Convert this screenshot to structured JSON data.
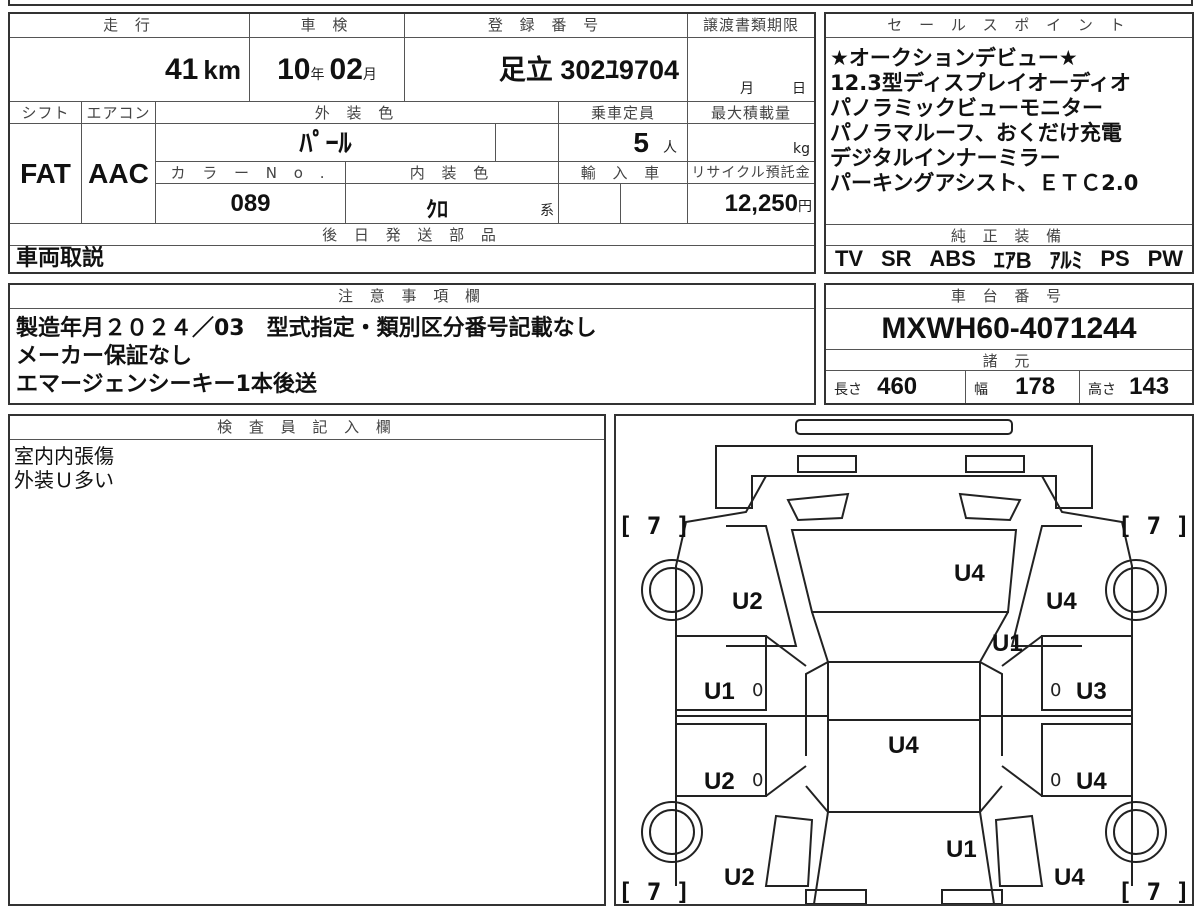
{
  "headers": {
    "mileage": "走 行",
    "inspection": "車 検",
    "registration": "登 録 番 号",
    "transfer_deadline": "譲渡書類期限",
    "shift": "シフト",
    "aircon": "エアコン",
    "exterior_color": "外 装 色",
    "capacity": "乗車定員",
    "max_load": "最大積載量",
    "color_no": "カ ラ ー N o .",
    "interior_color": "内 装 色",
    "import": "輸 入 車",
    "recycle": "リサイクル預託金",
    "later_parts": "後 日 発 送 部 品",
    "sales_points": "セ ー ル ス ポ イ ン ト",
    "genuine": "純 正 装 備",
    "notes": "注 意 事 項 欄",
    "chassis": "車 台 番 号",
    "specs": "諸 元",
    "inspector": "検 査 員 記 入 欄"
  },
  "vehicle": {
    "mileage_value": "41",
    "mileage_unit": "km",
    "inspection_year": "10",
    "year_unit": "年",
    "inspection_month": "02",
    "month_unit": "月",
    "registration_no": "足立 302ﾕ9704",
    "deadline_month_unit": "月",
    "deadline_day_unit": "日",
    "shift": "FAT",
    "aircon": "AAC",
    "exterior_color": "ﾊﾟｰﾙ",
    "capacity": "5",
    "capacity_unit": "人",
    "max_load_unit": "kg",
    "color_no": "089",
    "interior_color": "ｸﾛ",
    "interior_suffix": "系",
    "recycle_fee": "12,250",
    "recycle_unit": "円"
  },
  "later_parts": "車両取説",
  "sales_points": [
    "★オークションデビュー★",
    "12.3型ディスプレイオーディオ",
    "パノラミックビューモニター",
    "パノラマルーフ、おくだけ充電",
    "デジタルインナーミラー",
    "パーキングアシスト、ＥＴＣ2.0"
  ],
  "genuine_equipment": [
    "TV",
    "SR",
    "ABS",
    "ｴｱB",
    "ｱﾙﾐ",
    "PS",
    "PW"
  ],
  "notes": [
    "製造年月２０２４／03　型式指定・類別区分番号記載なし",
    "メーカー保証なし",
    "エマージェンシーキー1本後送"
  ],
  "chassis_no": "MXWH60-4071244",
  "specs": {
    "length_label": "長さ",
    "length": "460",
    "width_label": "幅",
    "width": "178",
    "height_label": "高さ",
    "height": "143"
  },
  "inspector_notes": [
    "室内内張傷",
    "外装Ｕ多い"
  ],
  "diagram": {
    "bracket_tl": "[ 7 ]",
    "bracket_tr": "[ 7 ]",
    "bracket_bl": "[ 7 ]",
    "bracket_br": "[ 7 ]",
    "hood": "U4",
    "front_left_fender": "U2",
    "front_right_fender": "U4",
    "windshield_right": "U1",
    "front_left_door": "U1",
    "front_right_door": "U3",
    "roof": "U4",
    "rear_left_door": "U2",
    "rear_right_door": "U4",
    "trunk": "U1",
    "rear_left_quarter": "U2",
    "rear_right_quarter": "U4",
    "zero1": "0",
    "zero2": "0",
    "zero3": "0",
    "zero4": "0"
  }
}
